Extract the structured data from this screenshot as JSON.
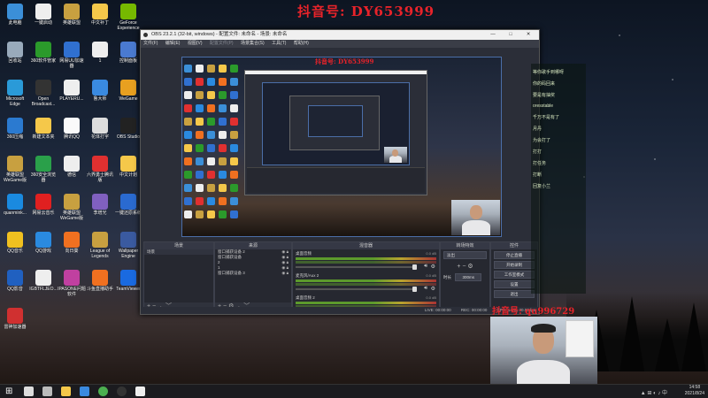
{
  "watermark": "抖音号: DY653999",
  "user_id": "抖音号: qu996729",
  "desktop_icons": [
    {
      "label": "此电脑",
      "color": "#3b8fd8",
      "icon": "pc-icon"
    },
    {
      "label": "一键启动",
      "color": "#eeeeee",
      "icon": "file-icon"
    },
    {
      "label": "英雄联盟",
      "color": "#c8a040",
      "icon": "lol-icon"
    },
    {
      "label": "中文补丁",
      "color": "#f5c84a",
      "icon": "folder-icon"
    },
    {
      "label": "GeForce Experience",
      "color": "#76b900",
      "icon": "nvidia-icon"
    },
    {
      "label": "回收站",
      "color": "#9ab",
      "icon": "recycle-bin-icon"
    },
    {
      "label": "360软件管家",
      "color": "#2b9a2b",
      "icon": "360-icon"
    },
    {
      "label": "网易UU加速器",
      "color": "#3070d0",
      "icon": "uu-icon"
    },
    {
      "label": "1",
      "color": "#eeeeee",
      "icon": "file-icon"
    },
    {
      "label": "控制面板",
      "color": "#4a7ad0",
      "icon": "control-panel-icon"
    },
    {
      "label": "Microsoft Edge",
      "color": "#2a9ad8",
      "icon": "edge-icon"
    },
    {
      "label": "Open Broadcast...",
      "color": "#333",
      "icon": "obs-icon"
    },
    {
      "label": "PLAYERU...",
      "color": "#eeeeee",
      "icon": "file-icon"
    },
    {
      "label": "鲁大师",
      "color": "#3a8ae0",
      "icon": "ludashi-icon"
    },
    {
      "label": "WeGame",
      "color": "#e8a020",
      "icon": "wegame-icon"
    },
    {
      "label": "360压缩",
      "color": "#2b7ad0",
      "icon": "zip-icon"
    },
    {
      "label": "新建文本夹",
      "color": "#f5c84a",
      "icon": "folder-icon"
    },
    {
      "label": "腾讯QQ",
      "color": "#fafafa",
      "icon": "qq-icon"
    },
    {
      "label": "花体打字",
      "color": "#ddd",
      "icon": "font-icon"
    },
    {
      "label": "OBS Studio",
      "color": "#222",
      "icon": "obs-icon"
    },
    {
      "label": "英雄联盟 WeGame版",
      "color": "#c8a040",
      "icon": "lol-icon"
    },
    {
      "label": "360安全浏览器",
      "color": "#2aa04a",
      "icon": "browser-icon"
    },
    {
      "label": "德信",
      "color": "#eeeeee",
      "icon": "file-icon"
    },
    {
      "label": "六界勇士腾讯版",
      "color": "#e03030",
      "icon": "game-icon"
    },
    {
      "label": "中文计划",
      "color": "#f5c84a",
      "icon": "folder-icon"
    },
    {
      "label": "quanmink...",
      "color": "#1a8ae0",
      "icon": "app-icon"
    },
    {
      "label": "网易云音乐",
      "color": "#e02020",
      "icon": "music-icon"
    },
    {
      "label": "英雄联盟 WeGame版",
      "color": "#c8a040",
      "icon": "lol-icon"
    },
    {
      "label": "李增光",
      "color": "#8060c0",
      "icon": "user-icon"
    },
    {
      "label": "一键还原系统",
      "color": "#2a6ad0",
      "icon": "restore-icon"
    },
    {
      "label": "QQ音乐",
      "color": "#f0c020",
      "icon": "qqmusic-icon"
    },
    {
      "label": "QQ游戏",
      "color": "#2a8ae0",
      "icon": "qqgame-icon"
    },
    {
      "label": "向日葵",
      "color": "#f07020",
      "icon": "sunflower-icon"
    },
    {
      "label": "League of Legends",
      "color": "#c8a040",
      "icon": "lol-icon"
    },
    {
      "label": "Wallpaper Engine",
      "color": "#3a5aa0",
      "icon": "wallpaper-icon"
    },
    {
      "label": "QQ影音",
      "color": "#2060c0",
      "icon": "player-icon"
    },
    {
      "label": "IGBTFLJEO...",
      "color": "#eeeeee",
      "icon": "file-icon"
    },
    {
      "label": "IPASONE问题软件",
      "color": "#c040a0",
      "icon": "app-icon"
    },
    {
      "label": "斗鱼直播助手",
      "color": "#f07020",
      "icon": "douyu-icon"
    },
    {
      "label": "TeamViewer",
      "color": "#1a6ae0",
      "icon": "teamviewer-icon"
    },
    {
      "label": "雷神加速器",
      "color": "#d03030",
      "icon": "thunder-icon"
    }
  ],
  "obs": {
    "title": "OBS 23.2.1 (32-bit, windows) - 配置文件: 未命名 - 场景: 未命名",
    "menus": [
      "文件(F)",
      "编辑(E)",
      "视图(V)",
      "配置文件(P)",
      "场景集合(S)",
      "工具(T)",
      "帮助(H)"
    ],
    "preview_watermark": "抖音号: DY653999",
    "docks": {
      "scenes": {
        "title": "场景",
        "items": [
          "场景"
        ]
      },
      "sources": {
        "title": "来源",
        "items": [
          "窗口捕获设备 2",
          "窗口捕获设备",
          "2",
          "1",
          "窗口捕获设备 3"
        ]
      },
      "mixer": {
        "title": "混音器",
        "channels": [
          {
            "name": "桌面音频",
            "db": "0.0 dB"
          },
          {
            "name": "麦克风/Aux 2",
            "db": "0.0 dB"
          },
          {
            "name": "桌面音频 2",
            "db": "0.0 dB"
          }
        ]
      },
      "transitions": {
        "title": "转场特效",
        "mode": "淡出",
        "duration_label": "时长",
        "duration": "300ms"
      },
      "controls": {
        "title": "控件",
        "buttons": [
          "停止直播",
          "开始录制",
          "工作室模式",
          "设置",
          "退出"
        ]
      }
    },
    "status": {
      "live": "LIVE: 00:00:00",
      "rec": "REC: 00:00:00",
      "cpu": "CPU: 1.5%, 30.00 fps"
    }
  },
  "chat_lines": [
    "等你歌手到哪呀",
    "你的码回来",
    "要是有抽奖",
    "oresstable",
    "千万不是有了",
    "月丹",
    "为会打了",
    "打打",
    "打任务",
    "打断",
    "回复小兰"
  ],
  "taskbar": {
    "apps": [
      "start-icon",
      "search-icon",
      "task-view-icon",
      "file-explorer-icon",
      "store-icon",
      "chrome-icon",
      "obs-icon",
      "file-icon"
    ],
    "time": "14:58",
    "date": "2021/8/24"
  },
  "colors": {
    "accent": "#4b6ea8",
    "watermark": "#e8232a"
  }
}
